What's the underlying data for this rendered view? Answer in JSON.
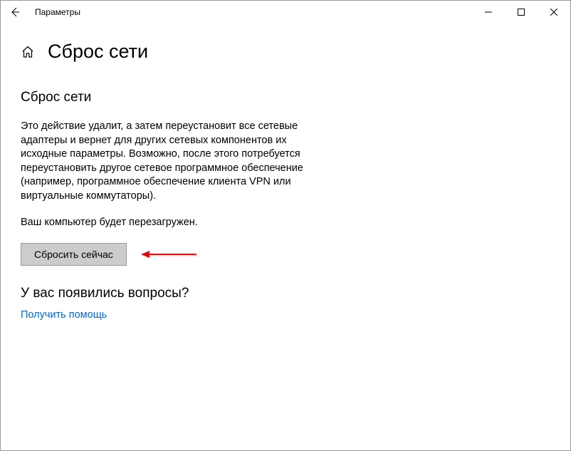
{
  "titlebar": {
    "app_title": "Параметры"
  },
  "header": {
    "page_title": "Сброс сети"
  },
  "main": {
    "section_heading": "Сброс сети",
    "description": "Это действие удалит, а затем переустановит все сетевые адаптеры и вернет для других сетевых компонентов их исходные параметры. Возможно, после этого потребуется переустановить другое сетевое программное обеспечение (например, программное обеспечение клиента VPN или виртуальные коммутаторы).",
    "restart_note": "Ваш компьютер будет перезагружен.",
    "reset_button_label": "Сбросить сейчас"
  },
  "help": {
    "heading": "У вас появились вопросы?",
    "link_label": "Получить помощь"
  },
  "annotation": {
    "arrow_color": "#e60000"
  }
}
